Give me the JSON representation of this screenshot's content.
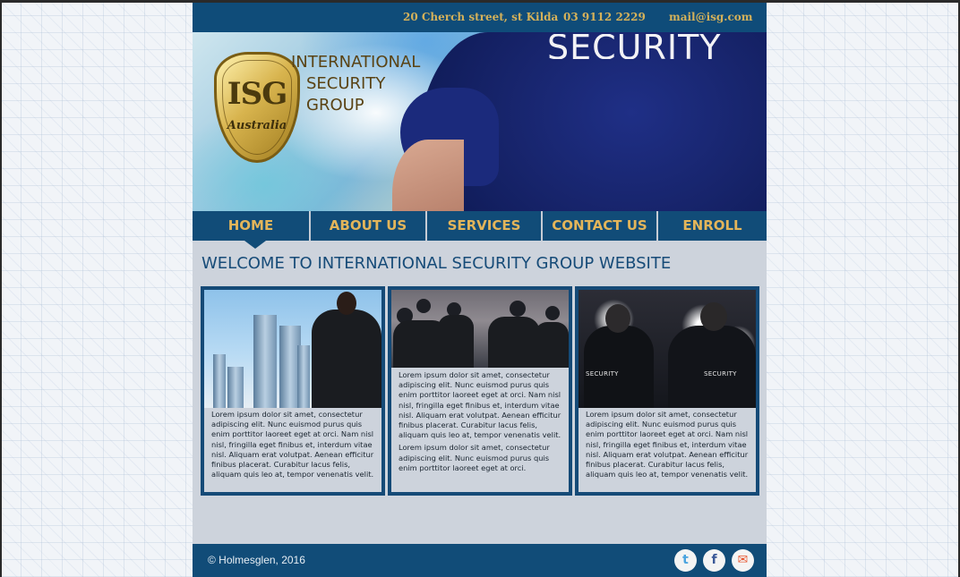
{
  "contact": {
    "address": "20 Cherch street, st Kilda",
    "phone": "03 9112 2229",
    "email": "mail@isg.com"
  },
  "hero": {
    "shirt_text": "SECURITY",
    "logo_mark": "ISG",
    "logo_sub": "Australia",
    "brand_lines": [
      "INTERNATIONAL",
      "SECURITY",
      "GROUP"
    ]
  },
  "nav": {
    "items": [
      {
        "label": "HOME",
        "active": true
      },
      {
        "label": "ABOUT US",
        "active": false
      },
      {
        "label": "SERVICES",
        "active": false
      },
      {
        "label": "CONTACT US",
        "active": false
      },
      {
        "label": "ENROLL",
        "active": false
      }
    ]
  },
  "main": {
    "welcome": "WELCOME TO INTERNATIONAL SECURITY GROUP WEBSITE",
    "cards": [
      {
        "image": "security-guard-city-photo",
        "paragraphs": [
          "Lorem ipsum dolor sit amet, consectetur adipiscing elit. Nunc euismod purus quis enim porttitor laoreet eget at orci. Nam nisl nisl, fringilla eget finibus et, interdum vitae nisl. Aliquam erat volutpat. Aenean efficitur finibus placerat. Curabitur lacus felis, aliquam quis leo at, tempor venenatis velit."
        ]
      },
      {
        "image": "police-crowd-photo",
        "paragraphs": [
          "Lorem ipsum dolor sit amet, consectetur adipiscing elit. Nunc euismod purus quis enim porttitor laoreet eget at orci. Nam nisl nisl, fringilla eget finibus et, interdum vitae nisl. Aliquam erat volutpat. Aenean efficitur finibus placerat. Curabitur lacus felis, aliquam quis leo at, tempor venenatis velit.",
          "Lorem ipsum dolor sit amet, consectetur adipiscing elit. Nunc euismod purus quis enim porttitor laoreet eget at orci."
        ]
      },
      {
        "image": "event-security-photo",
        "photo_tags": [
          "SECURITY",
          "SECURITY"
        ],
        "paragraphs": [
          "Lorem ipsum dolor sit amet, consectetur adipiscing elit. Nunc euismod purus quis enim porttitor laoreet eget at orci. Nam nisl nisl, fringilla eget finibus et, interdum vitae nisl. Aliquam erat volutpat. Aenean efficitur finibus placerat. Curabitur lacus felis, aliquam quis leo at, tempor venenatis velit."
        ]
      }
    ]
  },
  "footer": {
    "copyright": "© Holmesglen, 2016",
    "social": [
      {
        "icon": "twitter-icon",
        "glyph": "t",
        "color": "#4aa3df"
      },
      {
        "icon": "facebook-icon",
        "glyph": "f",
        "color": "#3b5998"
      },
      {
        "icon": "mail-icon",
        "glyph": "✉",
        "color": "#e8542c"
      }
    ]
  },
  "colors": {
    "primary": "#114c78",
    "accent_gold": "#e3b55a",
    "content_bg": "#cdd3dc"
  }
}
